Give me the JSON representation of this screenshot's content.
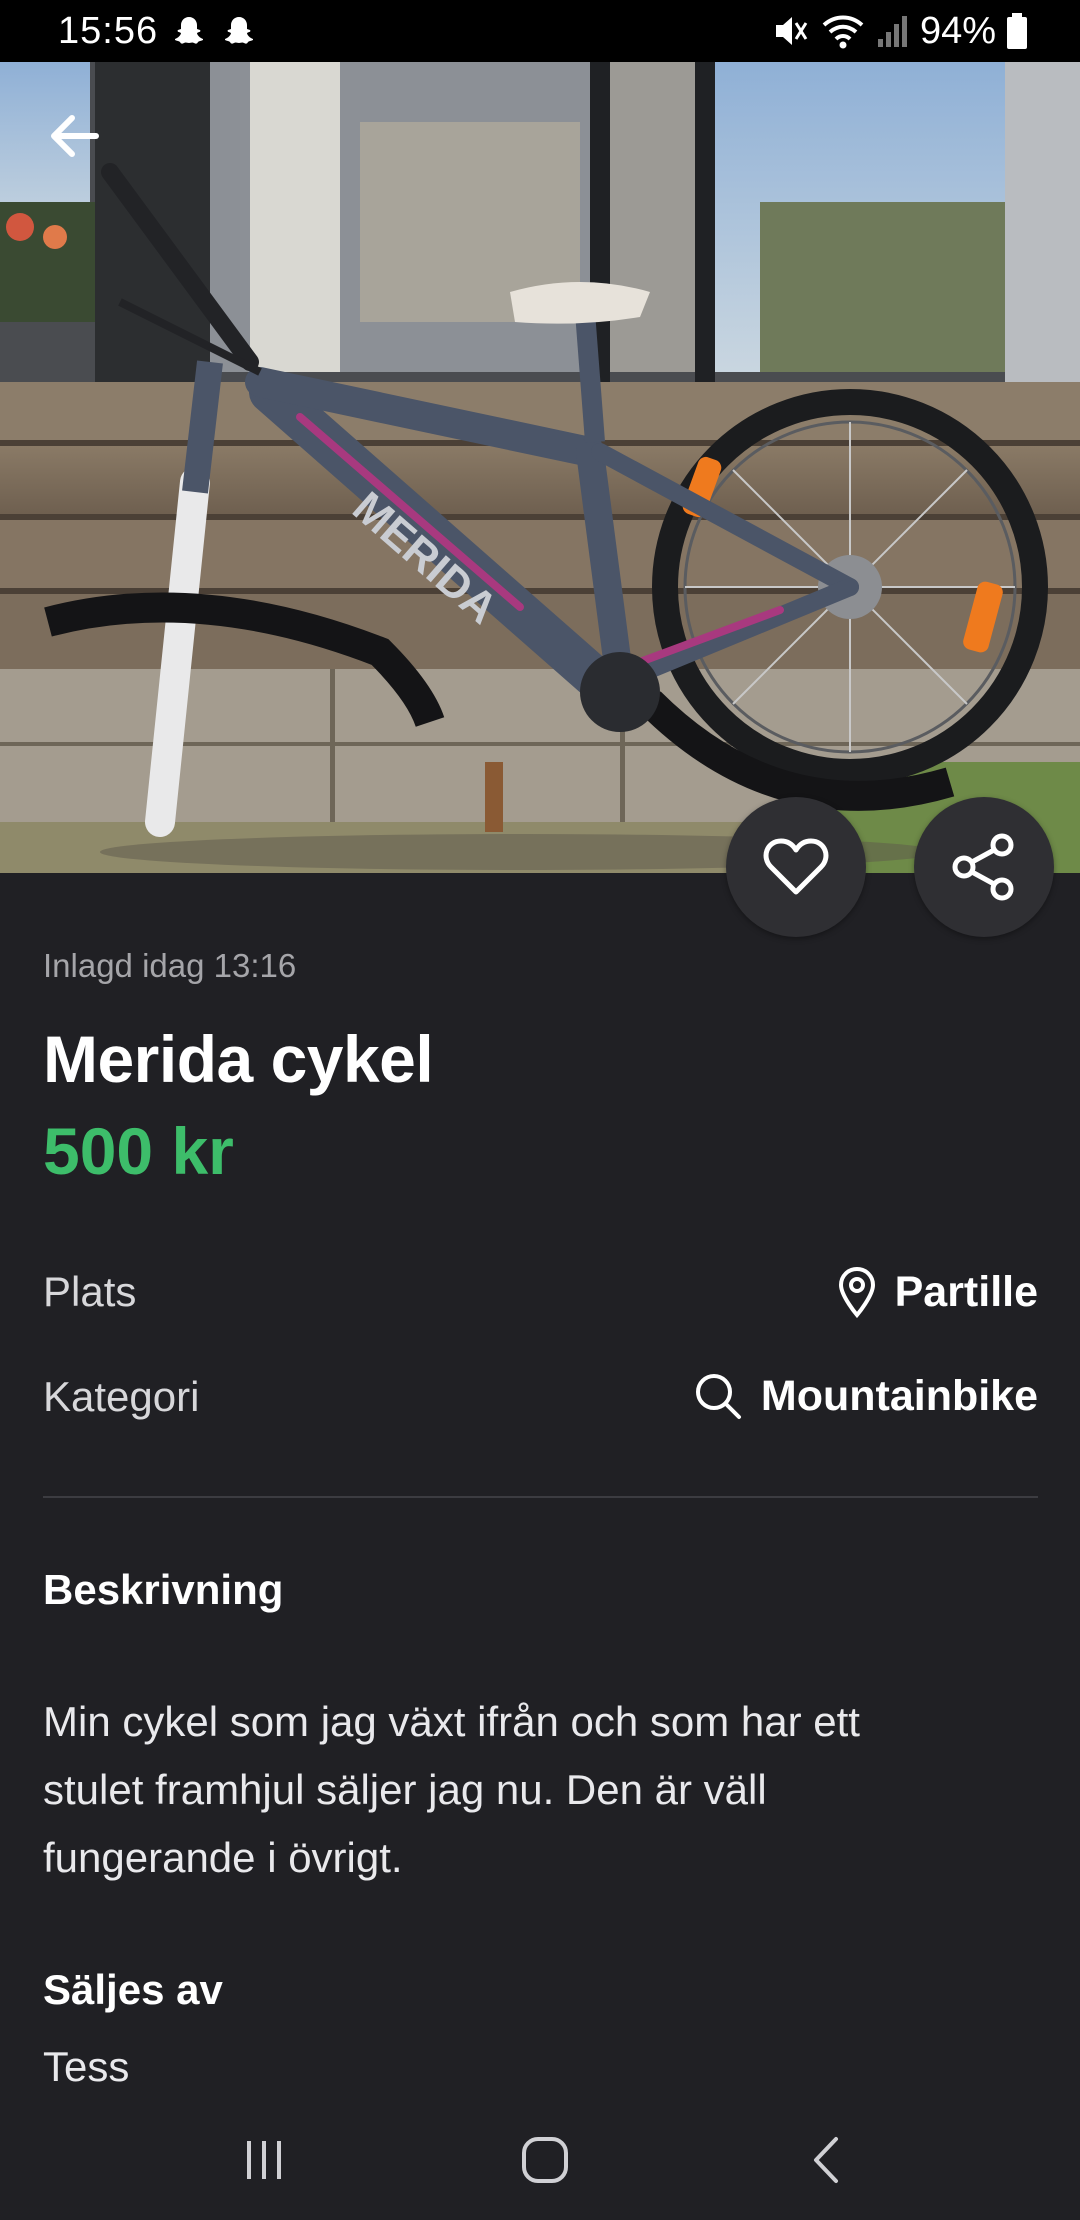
{
  "status_bar": {
    "time": "15:56",
    "battery": "94%",
    "icons": [
      "snapchat-icon",
      "snapchat-icon",
      "mute-icon",
      "wifi-icon",
      "signal-icon",
      "battery-icon"
    ]
  },
  "listing": {
    "posted": "Inlagd idag 13:16",
    "title": "Merida cykel",
    "price": "500 kr",
    "location_label": "Plats",
    "location_value": "Partille",
    "category_label": "Kategori",
    "category_value": "Mountainbike",
    "description_heading": "Beskrivning",
    "description": "Min cykel som jag växt ifrån och som har ett stulet framhjul säljer jag nu. Den är väll fungerande i övrigt.",
    "seller_heading": "Säljes av",
    "seller_name": "Tess"
  },
  "hero_image": {
    "brand_text": "MERIDA",
    "icons": [
      "back-arrow-icon",
      "heart-icon",
      "share-icon"
    ]
  },
  "navigation": {
    "icons": [
      "recent-apps-icon",
      "home-icon",
      "back-icon"
    ]
  },
  "colors": {
    "background": "#202024",
    "price": "#3dbd6a",
    "button": "#2f2f33",
    "muted_text": "#a5a5a9"
  }
}
